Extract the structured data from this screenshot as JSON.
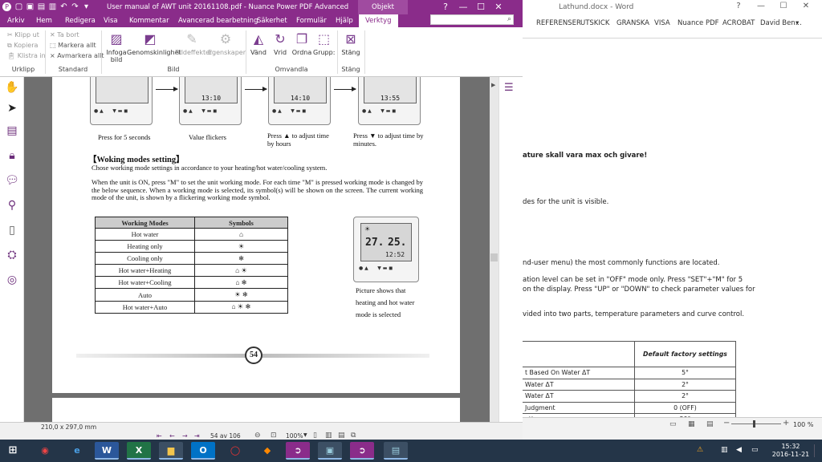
{
  "word": {
    "title": "Lathund.docx - Word",
    "caption_buttons": [
      "?",
      "—",
      "☐",
      "✕"
    ],
    "tabs": [
      "REFERENSER",
      "UTSKICK",
      "GRANSKA",
      "VISA",
      "Nuance PDF",
      "ACROBAT"
    ],
    "user": "David Ben...",
    "user_caret": "▾",
    "lines": [
      "ature skall vara max och givare!",
      "des for the unit is visible.",
      "nd-user menu) the most commonly functions are located.",
      "ation level can be set in \"OFF\" mode only. Press \"SET\"+\"M\" for 5",
      " on the display. Press \"UP\" or \"DOWN\" to check parameter values for",
      "vided into two parts, temperature parameters and curve control."
    ],
    "table": {
      "header": "Default factory settings",
      "rows": [
        {
          "label": "t Based On Water ΔT",
          "value": "5°"
        },
        {
          "label": "Water ΔT",
          "value": "2°"
        },
        {
          "label": "Water ΔT",
          "value": "2°"
        },
        {
          "label": " Judgment",
          "value": "0 (OFF)"
        },
        {
          "label": "ating",
          "value": "20°"
        }
      ]
    },
    "zoom": "100 %",
    "zoom_minus": "−",
    "zoom_plus": "+"
  },
  "pdf": {
    "title": "User manual of AWT unit 20161108.pdf - Nuance Power PDF Advanced",
    "context_tab": "Objekt",
    "caption_buttons": [
      "?",
      "—",
      "☐",
      "✕"
    ],
    "tabs": [
      "Arkiv",
      "Hem",
      "Redigera",
      "Visa",
      "Kommentar",
      "Avancerad bearbetning",
      "Säkerhet",
      "Formulär",
      "Hjälp",
      "Verktyg"
    ],
    "search_icon": "search-icon",
    "ribbon": {
      "urklipp": {
        "items": [
          "Klipp ut",
          "Kopiera",
          "Klistra in"
        ],
        "label": "Urklipp"
      },
      "standard": {
        "items": [
          "Ta bort",
          "Markera allt",
          "Avmarkera allt"
        ],
        "label": "Standard"
      },
      "bild": {
        "items": [
          "Infoga bild",
          "Genomskinlighet",
          "Bildeffekter",
          "Egenskaper"
        ],
        "label": "Bild"
      },
      "omvandla": {
        "items": [
          "Vänd",
          "Vrid",
          "Ordna",
          "Grupp:"
        ],
        "label": "Omvandla"
      },
      "stang": {
        "items": [
          "Stäng"
        ],
        "label": "Stäng"
      }
    },
    "status": {
      "page_size": "210,0 x 297,0 mm",
      "page_indicator": "54 av 106",
      "zoom": "100%"
    }
  },
  "manual": {
    "captions": [
      "Press for 5 seconds",
      "Value flickers",
      "Press ▲ to adjust time by hours",
      "Press ▼ to adjust time by minutes."
    ],
    "readings": [
      "",
      "13:10",
      "14:10",
      "13:55"
    ],
    "heading": "【Woking modes setting】",
    "intro": "Chose working mode settings in accordance to your heating/hot water/cooling system.",
    "para": "When the unit is ON, press \"M\" to set the unit working mode. For each time \"M\" is pressed working mode is changed by the below sequence. When a working mode is selected, its symbol(s) will be shown on the screen. The current working mode of the unit, is shown by a flickering working mode symbol.",
    "table_headers": [
      "Working Modes",
      "Symbols"
    ],
    "modes": [
      {
        "name": "Hot water",
        "symbols": "⌂"
      },
      {
        "name": "Heating only",
        "symbols": "☀"
      },
      {
        "name": "Cooling only",
        "symbols": "❄"
      },
      {
        "name": "Hot water+Heating",
        "symbols": "⌂ ☀"
      },
      {
        "name": "Hot water+Cooling",
        "symbols": "⌂ ❄"
      },
      {
        "name": "Auto",
        "symbols": "☀ ❄"
      },
      {
        "name": "Hot water+Auto",
        "symbols": "⌂ ☀ ❄"
      }
    ],
    "display_readings": [
      "27.",
      "25.",
      "12:52"
    ],
    "picture_caption": [
      "Picture shows that",
      "heating and hot water",
      "mode is selected"
    ],
    "page_number": "54"
  },
  "taskbar": {
    "time": "15:32",
    "date": "2016-11-21"
  }
}
